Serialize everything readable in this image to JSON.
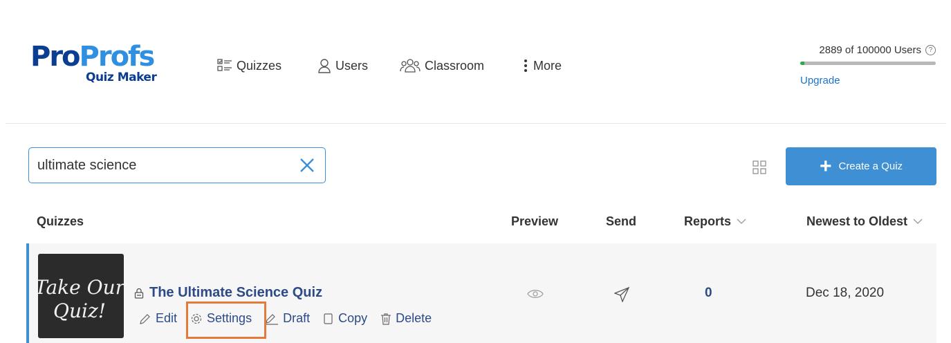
{
  "brand": {
    "logo_pro_1": "Pro",
    "logo_pro_2": "Profs",
    "logo_sub": "Quiz Maker"
  },
  "nav": {
    "quizzes": "Quizzes",
    "users": "Users",
    "classroom": "Classroom",
    "more": "More"
  },
  "usage": {
    "text": "2889  of  100000 Users",
    "upgrade": "Upgrade",
    "fraction": 0.029
  },
  "search": {
    "value": "ultimate science"
  },
  "create_button": "Create a Quiz",
  "table": {
    "headers": {
      "quizzes": "Quizzes",
      "preview": "Preview",
      "send": "Send",
      "reports": "Reports",
      "sort": "Newest to Oldest"
    },
    "rows": [
      {
        "thumbnail_text": "Take Our Quiz!",
        "title": "The Ultimate Science Quiz",
        "actions": {
          "edit": "Edit",
          "settings": "Settings",
          "draft": "Draft",
          "copy": "Copy",
          "delete": "Delete"
        },
        "reports": "0",
        "date": "Dec 18, 2020"
      }
    ]
  },
  "colors": {
    "accent": "#3f8fd4",
    "link": "#2c4a86",
    "highlight": "#e07b39",
    "logo_dark": "#0b3d91",
    "logo_light": "#2f8fe0"
  }
}
